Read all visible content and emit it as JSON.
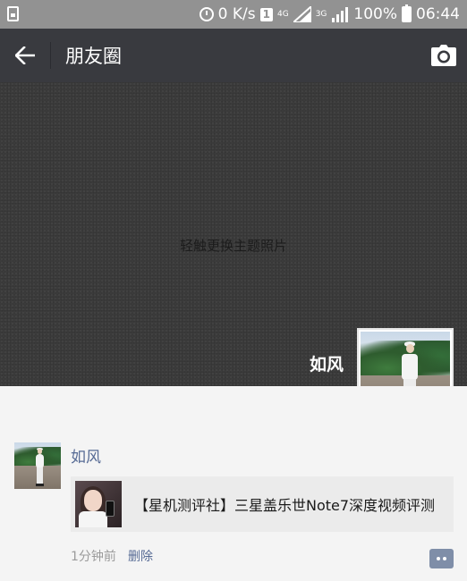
{
  "status_bar": {
    "network_speed": "0 K/s",
    "sim_slot": "1",
    "network_1": "4G",
    "network_2": "3G",
    "battery": "100%",
    "time": "06:44",
    "icons": [
      "sim-card-icon",
      "alarm-icon",
      "signal-icon",
      "battery-icon"
    ]
  },
  "header": {
    "title": "朋友圈",
    "back_icon": "arrow-left-icon",
    "camera_icon": "camera-icon"
  },
  "cover": {
    "hint": "轻触更换主题照片",
    "user_name": "如风"
  },
  "post": {
    "author": "如风",
    "link_title": "【星机测评社】三星盖乐世Note7深度视频评测",
    "time": "1分钟前",
    "delete_label": "删除",
    "comment_icon": "comment-icon"
  },
  "colors": {
    "title_bar": "#393a3f",
    "status_bar": "#929292",
    "link_blue": "#576b95",
    "cover_bg": "#3b3b3b"
  }
}
